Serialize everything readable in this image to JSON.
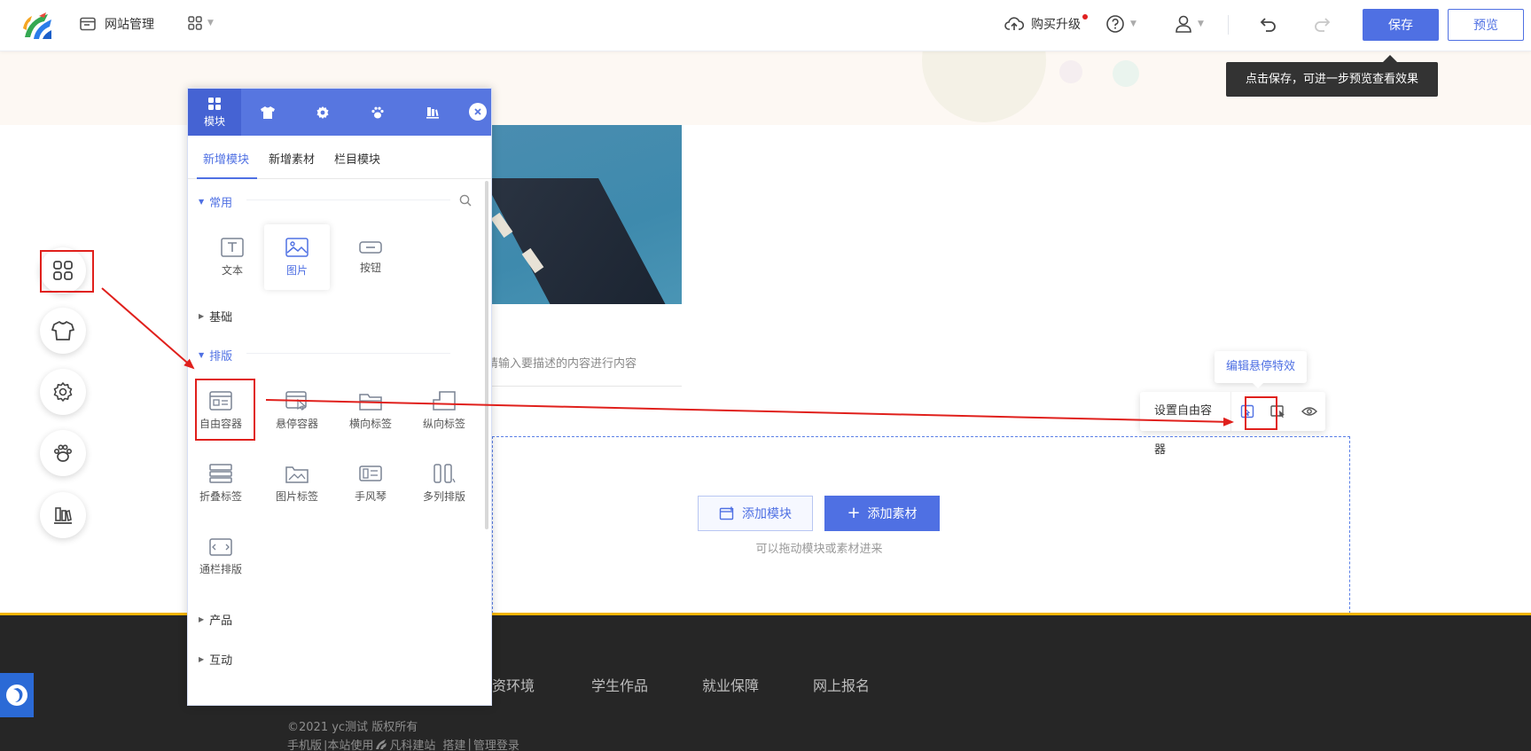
{
  "header": {
    "site_management": "网站管理",
    "buy_upgrade": "购买升级",
    "save": "保存",
    "preview": "预览",
    "save_tooltip": "点击保存，可进一步预览查看效果"
  },
  "panel": {
    "tabs": [
      {
        "icon": "grid-icon",
        "label": "模块"
      },
      {
        "icon": "shirt-icon",
        "label": ""
      },
      {
        "icon": "gear-icon",
        "label": ""
      },
      {
        "icon": "paw-icon",
        "label": ""
      },
      {
        "icon": "books-icon",
        "label": ""
      }
    ],
    "subtabs": [
      "新增模块",
      "新增素材",
      "栏目模块"
    ],
    "sections": {
      "common": "常用",
      "basic": "基础",
      "layout": "排版",
      "product": "产品",
      "interactive": "互动"
    },
    "common_modules": [
      "文本",
      "图片",
      "按钮"
    ],
    "layout_modules": [
      "自由容器",
      "悬停容器",
      "横向标签",
      "纵向标签",
      "折叠标签",
      "图片标签",
      "手风琴",
      "多列排版",
      "通栏排版"
    ]
  },
  "canvas": {
    "desc_placeholder": "请输入要描述的内容进行内容",
    "container_label": "设置自由容器",
    "hover_tip": "编辑悬停特效",
    "add_module": "添加模块",
    "add_material": "添加素材",
    "drag_hint": "可以拖动模块或素材进来"
  },
  "footer": {
    "nav": [
      "师资环境",
      "学生作品",
      "就业保障",
      "网上报名"
    ],
    "copyright": "©2021 yc测试 版权所有",
    "links": [
      "手机版",
      "|本站使用",
      "凡科建站",
      "搭建",
      "|",
      "管理登录"
    ]
  },
  "colors": {
    "primary": "#4f70e3",
    "panel_header": "#5776e0",
    "annotation": "#e0201c",
    "footer_bg": "#262626",
    "footer_border": "#f4b400"
  }
}
